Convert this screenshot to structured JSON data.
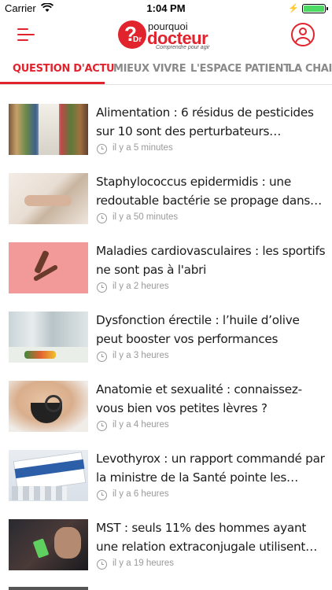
{
  "status_bar": {
    "carrier": "Carrier",
    "time": "1:04 PM",
    "battery_level": 1.0
  },
  "header": {
    "logo": {
      "line1": "pourquoi",
      "line2": "docteur",
      "slogan": "Comprendre pour agir",
      "mark": "?",
      "mark_sub": "Dr"
    },
    "menu_icon": "hamburger-icon",
    "profile_icon": "user-icon"
  },
  "tabs": [
    {
      "label": "QUESTION D'ACTU",
      "active": true
    },
    {
      "label": "MIEUX VIVRE",
      "active": false
    },
    {
      "label": "L'ESPACE PATIENT",
      "active": false
    },
    {
      "label": "LA CHAIN",
      "active": false
    }
  ],
  "articles": [
    {
      "title": "Alimentation : 6 résidus de pesticides sur 10 sont des perturbateurs endocriniens",
      "time": "il y a 5 minutes",
      "thumb": "supermarket-aisle"
    },
    {
      "title": "Staphylococcus epidermidis : une redoutable bactérie se propage dans les...",
      "time": "il y a 50 minutes",
      "thumb": "patient-in-bed"
    },
    {
      "title": "Maladies cardiovasculaires : les sportifs ne sont pas à l'abri",
      "time": "il y a 2 heures",
      "thumb": "runner"
    },
    {
      "title": "Dysfonction érectile : l’huile d’olive peut booster vos performances",
      "time": "il y a 3 heures",
      "thumb": "couple-cooking"
    },
    {
      "title": "Anatomie et sexualité : connaissez-vous bien vos petites lèvres ?",
      "time": "il y a 4 heures",
      "thumb": "magnifying-glass"
    },
    {
      "title": "Levothyrox : un rapport commandé par la ministre de la Santé pointe les responsa...",
      "time": "il y a 6 heures",
      "thumb": "medicine-box"
    },
    {
      "title": "MST : seuls 11% des hommes ayant une relation extraconjugale utilisent des pré...",
      "time": "il y a 19 heures",
      "thumb": "couple-phone"
    }
  ],
  "colors": {
    "accent": "#e1232d",
    "muted": "#8a8a8a",
    "text": "#1b1b1b"
  }
}
